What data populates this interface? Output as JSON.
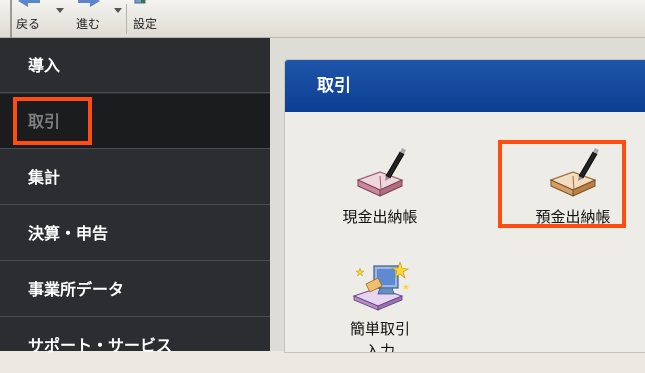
{
  "toolbar": {
    "back_label": "戻る",
    "forward_label": "進む",
    "settings_label": "設定"
  },
  "sidebar": {
    "items": [
      {
        "label": "導入"
      },
      {
        "label": "取引"
      },
      {
        "label": "集計"
      },
      {
        "label": "決算・申告"
      },
      {
        "label": "事業所データ"
      },
      {
        "label": "サポート・サービス"
      }
    ],
    "selected_index": 1
  },
  "panel": {
    "title": "取引",
    "items": [
      {
        "label": "現金出納帳",
        "icon": "ledger-pen-icon"
      },
      {
        "label": "預金出納帳",
        "icon": "ledger-pen-icon"
      },
      {
        "label_line1": "簡単取引",
        "label_line2": "入力",
        "icon": "simple-entry-icon"
      }
    ]
  },
  "colors": {
    "sidebar_bg": "#2b2d30",
    "panel_header": "#1e55aa",
    "highlight": "#ff4d12"
  }
}
